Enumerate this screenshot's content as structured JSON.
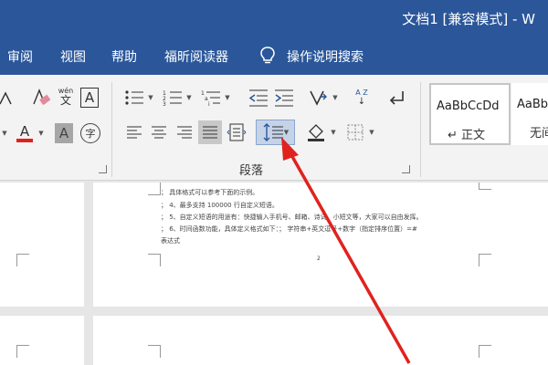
{
  "title_bar": {
    "document_title": "文档1 [兼容模式] - W"
  },
  "menu": {
    "tabs": [
      "审阅",
      "视图",
      "帮助",
      "福昕阅读器"
    ],
    "tell_me": "操作说明搜索"
  },
  "ribbon": {
    "font_group": {
      "pinyin_label": "wén",
      "font_color_glyph": "A",
      "char_shading_glyph": "A",
      "enclose_glyph": "字",
      "border_glyph": "A"
    },
    "sort_label": "A Z",
    "paragraph_group_label": "段落"
  },
  "styles": {
    "normal": {
      "sample": "AaBbCcDd",
      "name": "↵ 正文"
    },
    "no_spacing": {
      "sample": "AaBbC",
      "name": "无间"
    }
  },
  "document": {
    "lines": [
      "；  具体格式可以参考下面的示例。",
      "；  4、最多支持 100000 行自定义短语。",
      "；  5、自定义短语的用途有：快捷输入手机号、邮箱、诗词、小短文等，大家可以自由发挥。",
      "；  6、时间函数功能，具体定义格式如下：；  字符串+英文逗号+数字（指定排序位置）=#",
      "表达式"
    ],
    "page_number": "2"
  },
  "colors": {
    "title_bar": "#2b579a",
    "ribbon": "#f3f3f3",
    "arrow": "#e0221e"
  }
}
